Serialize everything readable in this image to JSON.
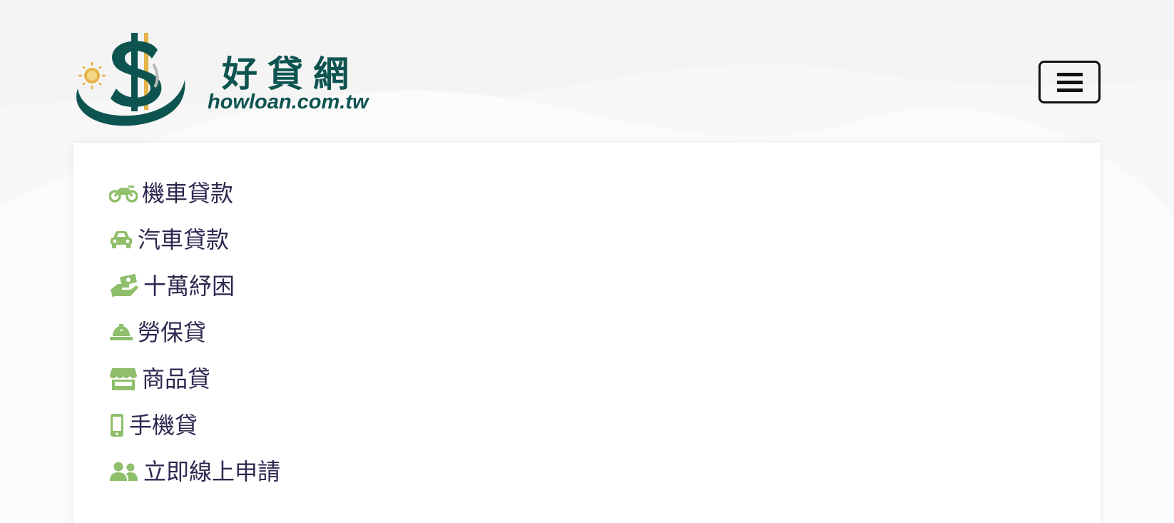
{
  "brand": {
    "name_cn": "好貸網",
    "domain": "howloan.com.tw"
  },
  "colors": {
    "brand_green": "#0d5450",
    "icon_green": "#8fbf6a",
    "text_dark": "#2e2850",
    "gold": "#e3b447"
  },
  "nav": {
    "items": [
      {
        "label": "機車貸款",
        "icon": "motorcycle-icon"
      },
      {
        "label": "汽車貸款",
        "icon": "car-icon"
      },
      {
        "label": "十萬紓困",
        "icon": "hand-holding-money-icon"
      },
      {
        "label": "勞保貸",
        "icon": "hard-hat-icon"
      },
      {
        "label": "商品貸",
        "icon": "store-icon"
      },
      {
        "label": "手機貸",
        "icon": "mobile-phone-icon"
      },
      {
        "label": "立即線上申請",
        "icon": "users-icon"
      }
    ]
  }
}
